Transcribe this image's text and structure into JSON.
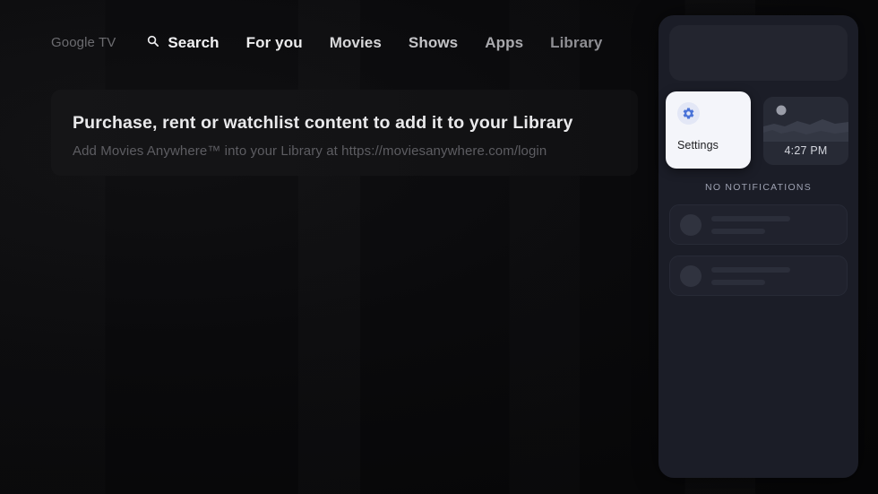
{
  "nav": {
    "brand": "Google TV",
    "brand_word1": "Google",
    "brand_word2": "TV",
    "items": [
      {
        "label": "Search",
        "icon": "search-icon"
      },
      {
        "label": "For you",
        "icon": ""
      },
      {
        "label": "Movies",
        "icon": ""
      },
      {
        "label": "Shows",
        "icon": ""
      },
      {
        "label": "Apps",
        "icon": ""
      },
      {
        "label": "Library",
        "icon": ""
      }
    ]
  },
  "banner": {
    "title": "Purchase, rent or watchlist content to add it to your Library",
    "subtitle": "Add Movies Anywhere™ into your Library at https://moviesanywhere.com/login"
  },
  "side_panel": {
    "tiles": [
      {
        "label": "Settings",
        "icon": "gear-icon",
        "focused": true
      },
      {
        "label": "4:27 PM",
        "icon": "moon-icon",
        "focused": false
      }
    ],
    "notifications_header": "NO NOTIFICATIONS",
    "notification_placeholders": 2
  },
  "colors": {
    "background": "#0a0a0c",
    "banner_card": "#151517",
    "panel": "#1b1d27",
    "panel_card": "#23252f",
    "tile_focused_bg": "#f4f5fa",
    "tile_focused_text": "#1d1d20",
    "gear_accent": "#4a73d8",
    "gear_halo": "#e3e7f6",
    "time_tile_bg": "#272a35",
    "notification_card": "#20222d",
    "muted_text": "#9ea2b2",
    "nav_active_text": "#f2f2f4",
    "brand_text": "#6c6c70"
  }
}
